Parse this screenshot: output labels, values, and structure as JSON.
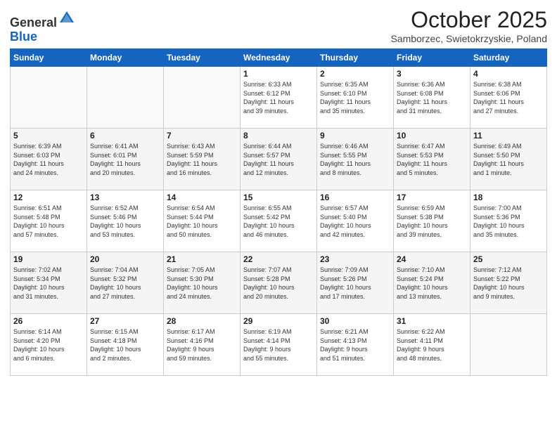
{
  "logo": {
    "general": "General",
    "blue": "Blue"
  },
  "header": {
    "title": "October 2025",
    "subtitle": "Samborzec, Swietokrzyskie, Poland"
  },
  "days_of_week": [
    "Sunday",
    "Monday",
    "Tuesday",
    "Wednesday",
    "Thursday",
    "Friday",
    "Saturday"
  ],
  "weeks": [
    {
      "shade": false,
      "days": [
        {
          "num": "",
          "info": ""
        },
        {
          "num": "",
          "info": ""
        },
        {
          "num": "",
          "info": ""
        },
        {
          "num": "1",
          "info": "Sunrise: 6:33 AM\nSunset: 6:12 PM\nDaylight: 11 hours\nand 39 minutes."
        },
        {
          "num": "2",
          "info": "Sunrise: 6:35 AM\nSunset: 6:10 PM\nDaylight: 11 hours\nand 35 minutes."
        },
        {
          "num": "3",
          "info": "Sunrise: 6:36 AM\nSunset: 6:08 PM\nDaylight: 11 hours\nand 31 minutes."
        },
        {
          "num": "4",
          "info": "Sunrise: 6:38 AM\nSunset: 6:06 PM\nDaylight: 11 hours\nand 27 minutes."
        }
      ]
    },
    {
      "shade": true,
      "days": [
        {
          "num": "5",
          "info": "Sunrise: 6:39 AM\nSunset: 6:03 PM\nDaylight: 11 hours\nand 24 minutes."
        },
        {
          "num": "6",
          "info": "Sunrise: 6:41 AM\nSunset: 6:01 PM\nDaylight: 11 hours\nand 20 minutes."
        },
        {
          "num": "7",
          "info": "Sunrise: 6:43 AM\nSunset: 5:59 PM\nDaylight: 11 hours\nand 16 minutes."
        },
        {
          "num": "8",
          "info": "Sunrise: 6:44 AM\nSunset: 5:57 PM\nDaylight: 11 hours\nand 12 minutes."
        },
        {
          "num": "9",
          "info": "Sunrise: 6:46 AM\nSunset: 5:55 PM\nDaylight: 11 hours\nand 8 minutes."
        },
        {
          "num": "10",
          "info": "Sunrise: 6:47 AM\nSunset: 5:53 PM\nDaylight: 11 hours\nand 5 minutes."
        },
        {
          "num": "11",
          "info": "Sunrise: 6:49 AM\nSunset: 5:50 PM\nDaylight: 11 hours\nand 1 minute."
        }
      ]
    },
    {
      "shade": false,
      "days": [
        {
          "num": "12",
          "info": "Sunrise: 6:51 AM\nSunset: 5:48 PM\nDaylight: 10 hours\nand 57 minutes."
        },
        {
          "num": "13",
          "info": "Sunrise: 6:52 AM\nSunset: 5:46 PM\nDaylight: 10 hours\nand 53 minutes."
        },
        {
          "num": "14",
          "info": "Sunrise: 6:54 AM\nSunset: 5:44 PM\nDaylight: 10 hours\nand 50 minutes."
        },
        {
          "num": "15",
          "info": "Sunrise: 6:55 AM\nSunset: 5:42 PM\nDaylight: 10 hours\nand 46 minutes."
        },
        {
          "num": "16",
          "info": "Sunrise: 6:57 AM\nSunset: 5:40 PM\nDaylight: 10 hours\nand 42 minutes."
        },
        {
          "num": "17",
          "info": "Sunrise: 6:59 AM\nSunset: 5:38 PM\nDaylight: 10 hours\nand 39 minutes."
        },
        {
          "num": "18",
          "info": "Sunrise: 7:00 AM\nSunset: 5:36 PM\nDaylight: 10 hours\nand 35 minutes."
        }
      ]
    },
    {
      "shade": true,
      "days": [
        {
          "num": "19",
          "info": "Sunrise: 7:02 AM\nSunset: 5:34 PM\nDaylight: 10 hours\nand 31 minutes."
        },
        {
          "num": "20",
          "info": "Sunrise: 7:04 AM\nSunset: 5:32 PM\nDaylight: 10 hours\nand 27 minutes."
        },
        {
          "num": "21",
          "info": "Sunrise: 7:05 AM\nSunset: 5:30 PM\nDaylight: 10 hours\nand 24 minutes."
        },
        {
          "num": "22",
          "info": "Sunrise: 7:07 AM\nSunset: 5:28 PM\nDaylight: 10 hours\nand 20 minutes."
        },
        {
          "num": "23",
          "info": "Sunrise: 7:09 AM\nSunset: 5:26 PM\nDaylight: 10 hours\nand 17 minutes."
        },
        {
          "num": "24",
          "info": "Sunrise: 7:10 AM\nSunset: 5:24 PM\nDaylight: 10 hours\nand 13 minutes."
        },
        {
          "num": "25",
          "info": "Sunrise: 7:12 AM\nSunset: 5:22 PM\nDaylight: 10 hours\nand 9 minutes."
        }
      ]
    },
    {
      "shade": false,
      "days": [
        {
          "num": "26",
          "info": "Sunrise: 6:14 AM\nSunset: 4:20 PM\nDaylight: 10 hours\nand 6 minutes."
        },
        {
          "num": "27",
          "info": "Sunrise: 6:15 AM\nSunset: 4:18 PM\nDaylight: 10 hours\nand 2 minutes."
        },
        {
          "num": "28",
          "info": "Sunrise: 6:17 AM\nSunset: 4:16 PM\nDaylight: 9 hours\nand 59 minutes."
        },
        {
          "num": "29",
          "info": "Sunrise: 6:19 AM\nSunset: 4:14 PM\nDaylight: 9 hours\nand 55 minutes."
        },
        {
          "num": "30",
          "info": "Sunrise: 6:21 AM\nSunset: 4:13 PM\nDaylight: 9 hours\nand 51 minutes."
        },
        {
          "num": "31",
          "info": "Sunrise: 6:22 AM\nSunset: 4:11 PM\nDaylight: 9 hours\nand 48 minutes."
        },
        {
          "num": "",
          "info": ""
        }
      ]
    }
  ]
}
